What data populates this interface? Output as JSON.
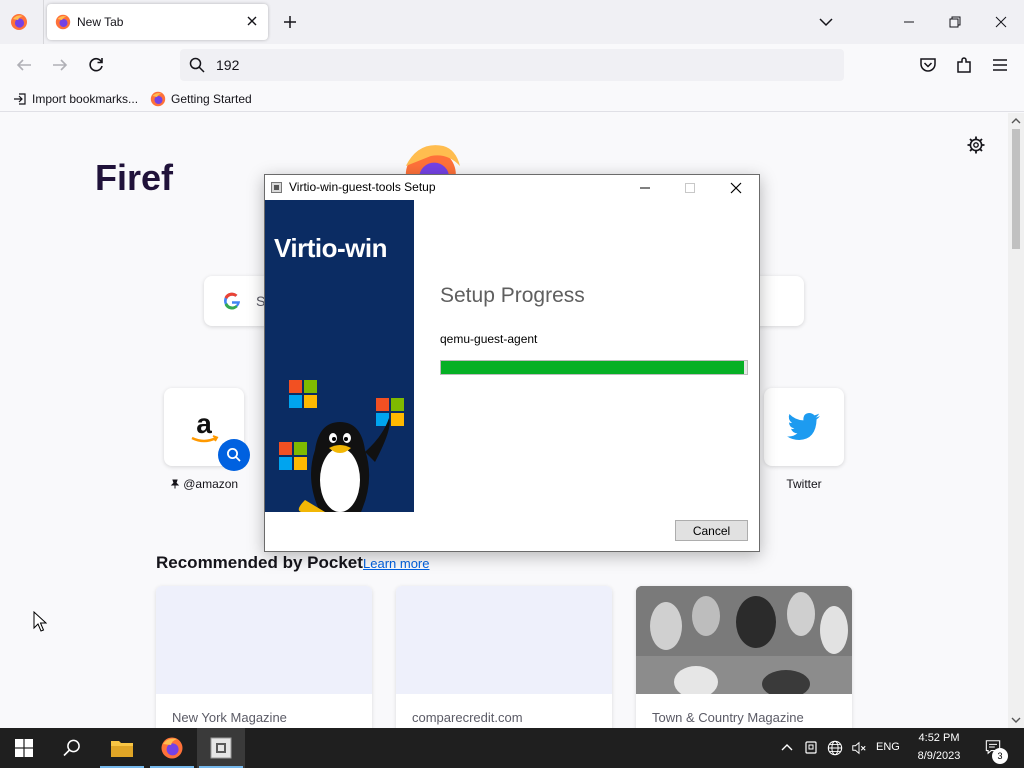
{
  "browser": {
    "tab": {
      "title": "New Tab"
    },
    "url": "192",
    "bookmarks": [
      "Import bookmarks...",
      "Getting Started"
    ]
  },
  "newtab": {
    "brand_visible": "Firef",
    "search_hint": "S",
    "shortcuts": [
      {
        "label": "@amazon",
        "icon": "amazon-logo"
      },
      {
        "label": "Twitter",
        "icon": "twitter-bird"
      }
    ],
    "pocket": {
      "heading": "Recommended by Pocket",
      "learn_more": "Learn more",
      "cards": [
        "New York Magazine",
        "comparecredit.com",
        "Town & Country Magazine"
      ]
    }
  },
  "dialog": {
    "title": "Virtio-win-guest-tools Setup",
    "banner": "Virtio-win",
    "heading": "Setup Progress",
    "current_item": "qemu-guest-agent",
    "progress_fraction": 0.99,
    "cancel_label": "Cancel"
  },
  "taskbar": {
    "language": "ENG",
    "time": "4:52 PM",
    "date": "8/9/2023",
    "notification_count": "3"
  },
  "colors": {
    "progress": "#06b025",
    "banner": "#0b2c63",
    "link": "#0061e0",
    "taskbar": "#1f1f1f"
  }
}
